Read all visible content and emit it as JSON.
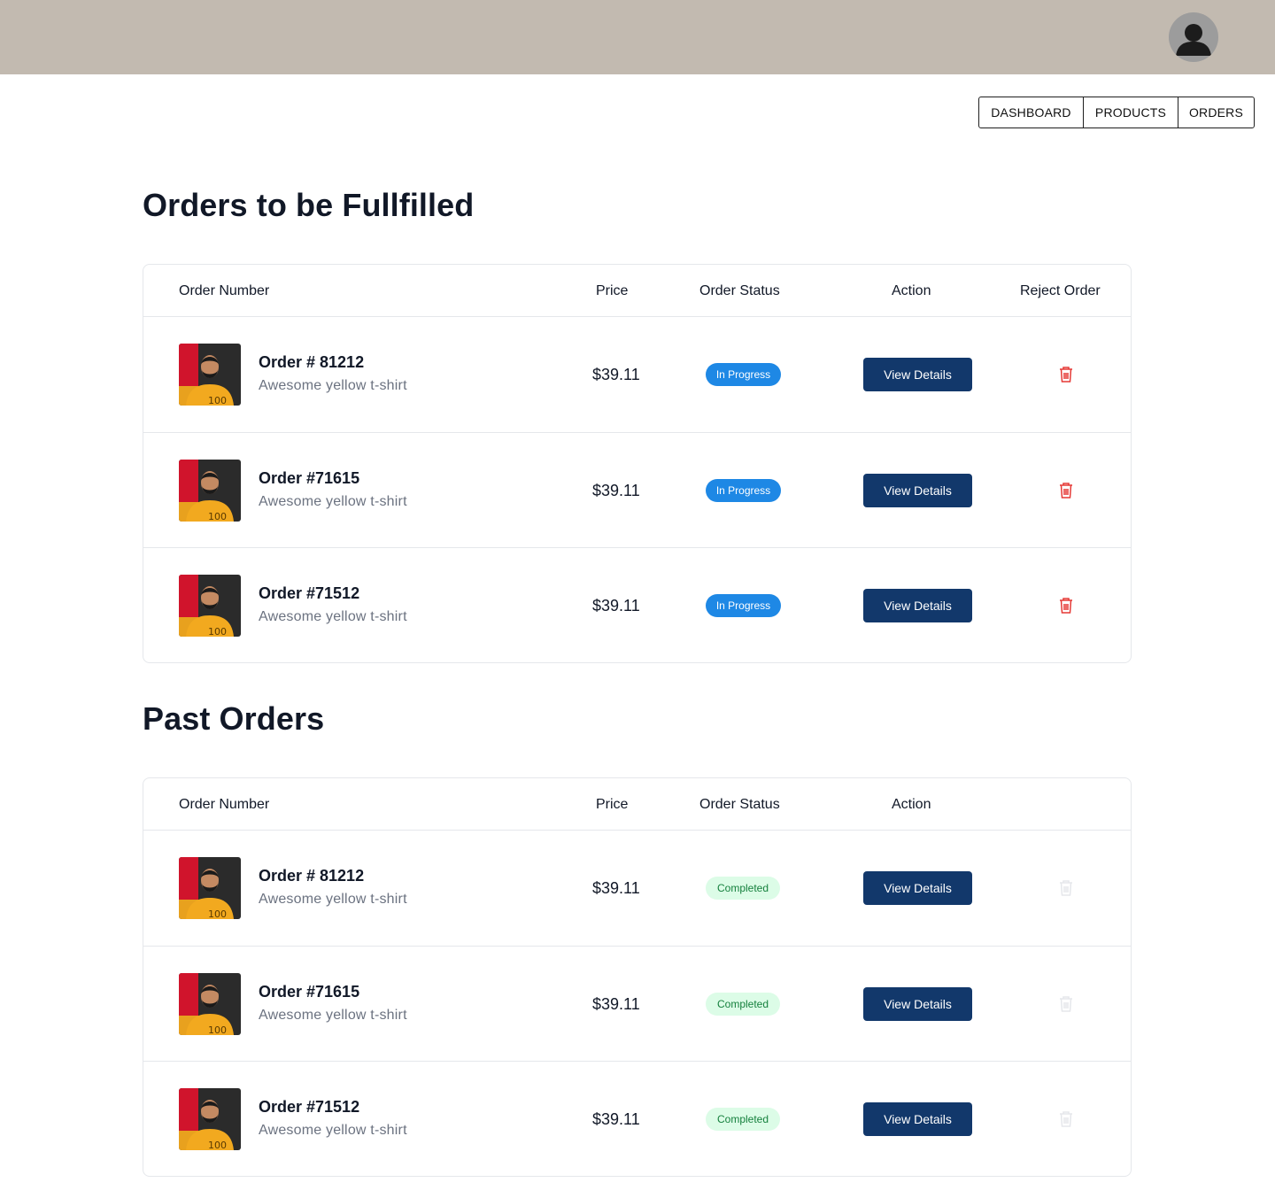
{
  "header": {
    "avatar_icon": "user-avatar-icon",
    "bg_color": "#c2bab0"
  },
  "nav": {
    "items": [
      "DASHBOARD",
      "PRODUCTS",
      "ORDERS"
    ]
  },
  "pending": {
    "title": "Orders to be Fullfilled",
    "columns": [
      "Order Number",
      "Price",
      "Order Status",
      "Action",
      "Reject Order"
    ],
    "rows": [
      {
        "order": "Order # 81212",
        "desc": "Awesome yellow t-shirt",
        "price": "$39.11",
        "status": "In Progress",
        "action": "View Details"
      },
      {
        "order": "Order #71615",
        "desc": "Awesome yellow t-shirt",
        "price": "$39.11",
        "status": "In Progress",
        "action": "View Details"
      },
      {
        "order": "Order #71512",
        "desc": "Awesome yellow t-shirt",
        "price": "$39.11",
        "status": "In Progress",
        "action": "View Details"
      }
    ]
  },
  "past": {
    "title": "Past Orders",
    "columns": [
      "Order Number",
      "Price",
      "Order Status",
      "Action"
    ],
    "rows": [
      {
        "order": "Order # 81212",
        "desc": "Awesome yellow t-shirt",
        "price": "$39.11",
        "status": "Completed",
        "action": "View Details"
      },
      {
        "order": "Order #71615",
        "desc": "Awesome yellow t-shirt",
        "price": "$39.11",
        "status": "Completed",
        "action": "View Details"
      },
      {
        "order": "Order #71512",
        "desc": "Awesome yellow t-shirt",
        "price": "$39.11",
        "status": "Completed",
        "action": "View Details"
      }
    ]
  },
  "colors": {
    "primary_button": "#12386b",
    "progress_badge": "#1e88e5",
    "completed_badge_bg": "#dcfce7",
    "completed_badge_text": "#15803d",
    "trash_active": "#e53935",
    "trash_disabled": "#e5e7eb"
  }
}
